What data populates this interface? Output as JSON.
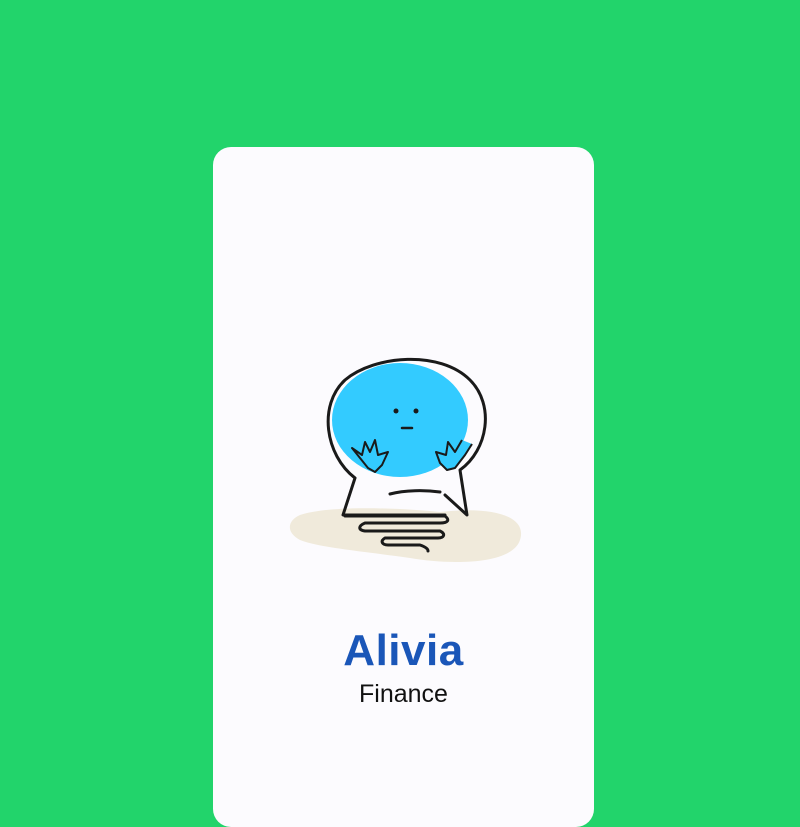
{
  "app": {
    "name": "Alivia",
    "subtitle": "Finance"
  },
  "colors": {
    "background": "#22D46B",
    "card": "#FCFBFE",
    "brand": "#1A56B8",
    "mascot": "#33CBFF",
    "shadow": "#F0EADB"
  },
  "illustration": {
    "icon": "speech-bubble-mascot-icon"
  }
}
